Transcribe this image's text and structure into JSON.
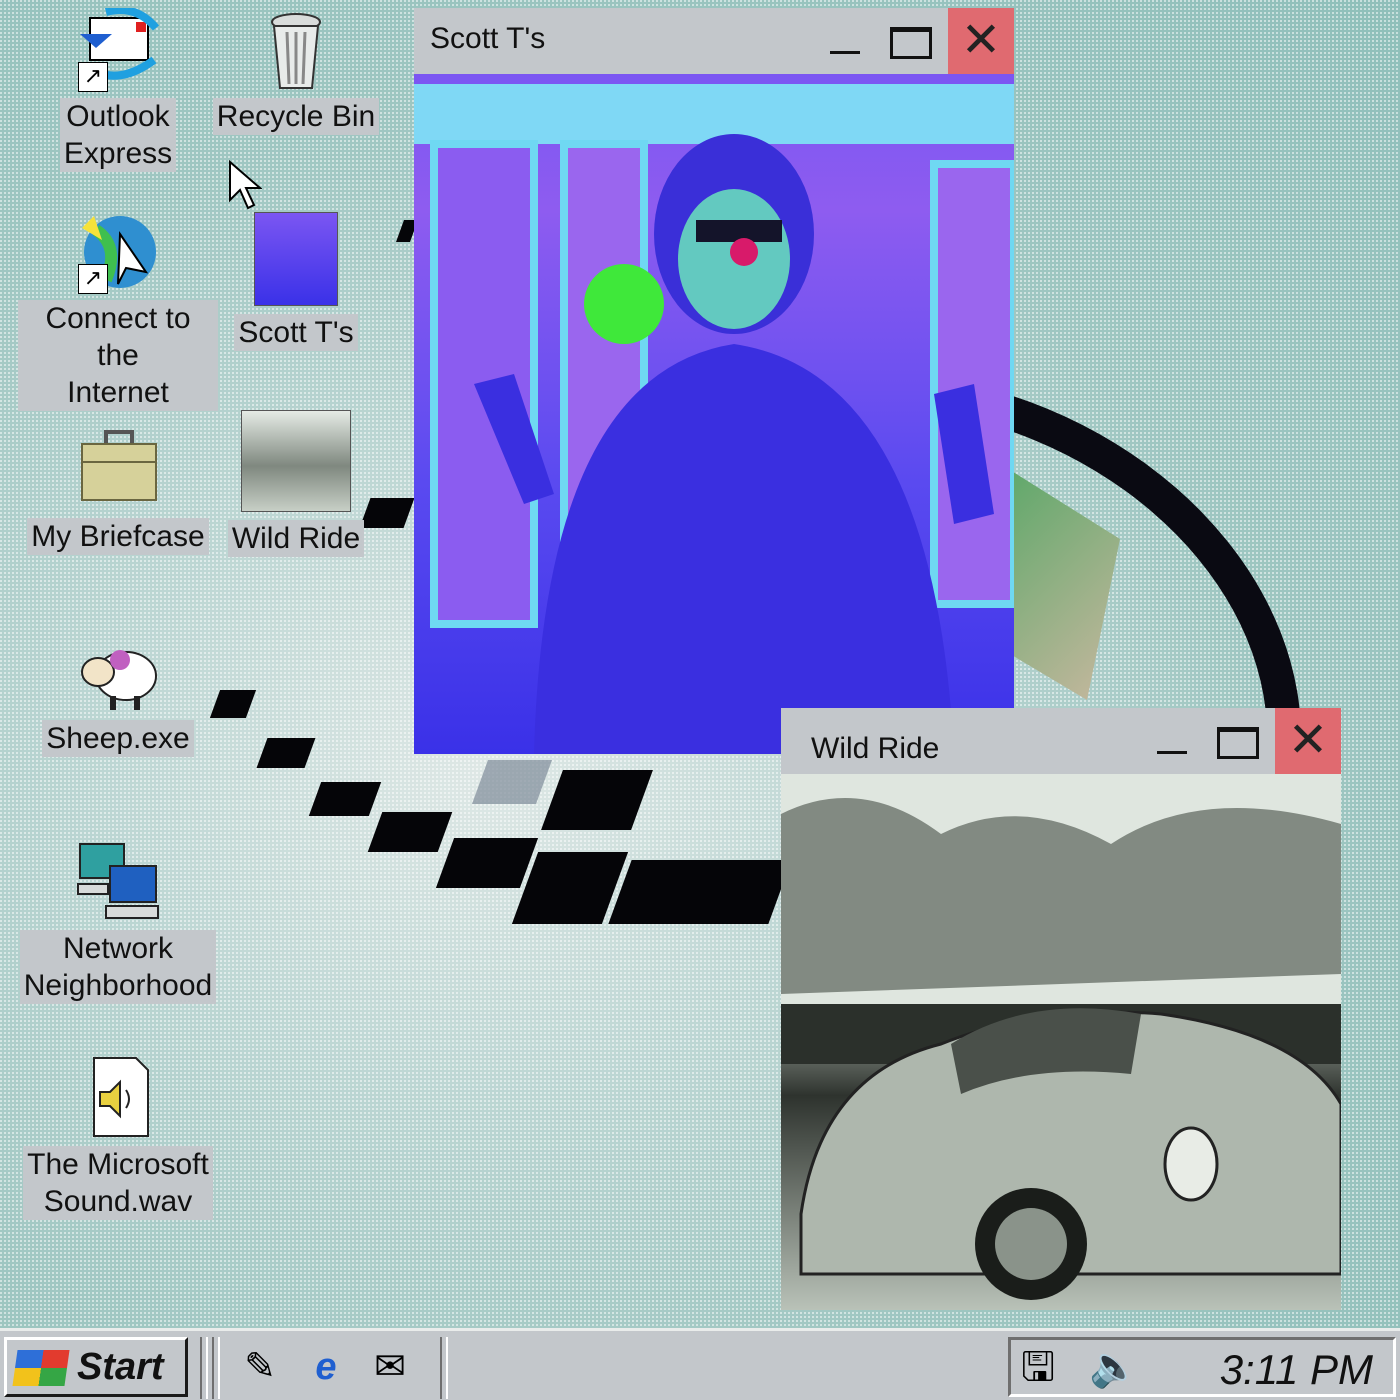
{
  "desktop": {
    "icons": [
      {
        "label_line1": "Outlook",
        "label_line2": "Express",
        "icon": "outlook-express-icon"
      },
      {
        "label_line1": "Recycle Bin",
        "label_line2": "",
        "icon": "recycle-bin-icon"
      },
      {
        "label_line1": "Connect to the",
        "label_line2": "Internet",
        "icon": "connect-internet-icon"
      },
      {
        "label_line1": "Scott T's",
        "label_line2": "",
        "icon": "image-file-icon"
      },
      {
        "label_line1": "My Briefcase",
        "label_line2": "",
        "icon": "briefcase-icon"
      },
      {
        "label_line1": "Wild Ride",
        "label_line2": "",
        "icon": "image-file-icon"
      },
      {
        "label_line1": "Sheep.exe",
        "label_line2": "",
        "icon": "sheep-icon"
      },
      {
        "label_line1": "Network",
        "label_line2": "Neighborhood",
        "icon": "network-neighborhood-icon"
      },
      {
        "label_line1": "The Microsoft",
        "label_line2": "Sound.wav",
        "icon": "sound-file-icon"
      }
    ]
  },
  "windows": {
    "scott": {
      "title": "Scott T's"
    },
    "wild": {
      "title": "Wild Ride"
    }
  },
  "taskbar": {
    "start_label": "Start",
    "clock": "3:11 PM"
  },
  "colors": {
    "close_button": "#e06a70",
    "chrome": "#c3c7cb"
  }
}
